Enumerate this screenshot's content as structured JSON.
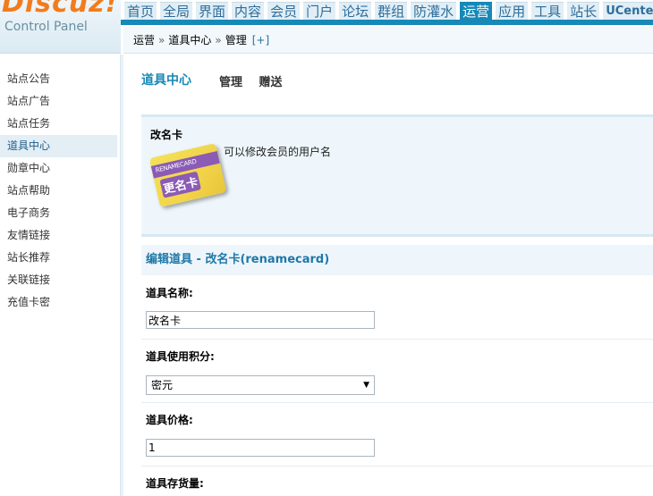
{
  "logo": {
    "main": "Discuz!",
    "sub": "Control Panel"
  },
  "topnav": {
    "tabs": [
      "首页",
      "全局",
      "界面",
      "内容",
      "会员",
      "门户",
      "论坛",
      "群组",
      "防灌水",
      "运营",
      "应用",
      "工具",
      "站长",
      "UCenter"
    ],
    "active_index": 9
  },
  "breadcrumb": {
    "items": [
      "运营",
      "道具中心",
      "管理"
    ],
    "separator": "»",
    "add": "[+]"
  },
  "sidebar": {
    "items": [
      "站点公告",
      "站点广告",
      "站点任务",
      "道具中心",
      "勋章中心",
      "站点帮助",
      "电子商务",
      "友情链接",
      "站长推荐",
      "关联链接",
      "充值卡密"
    ],
    "active_index": 3
  },
  "main": {
    "title": "道具中心",
    "links": [
      "管理",
      "赠送"
    ],
    "item": {
      "name": "改名卡",
      "description": "可以修改会员的用户名",
      "card_label": "更名卡",
      "card_stripe": "RENAMECARD"
    },
    "edit_title": "编辑道具 - 改名卡(renamecard)",
    "fields": {
      "name_label": "道具名称:",
      "name_value": "改名卡",
      "credit_label": "道具使用积分:",
      "credit_value": "密元",
      "price_label": "道具价格:",
      "price_value": "1",
      "stock_label": "道具存货量:"
    }
  },
  "colors": {
    "accent": "#1689b8",
    "logo": "#f37b1c",
    "card_purple": "#8b5bb5",
    "card_yellow": "#f2d44a"
  },
  "icons": {
    "select_arrow": "caret-down-icon",
    "card": "rename-card-icon"
  }
}
